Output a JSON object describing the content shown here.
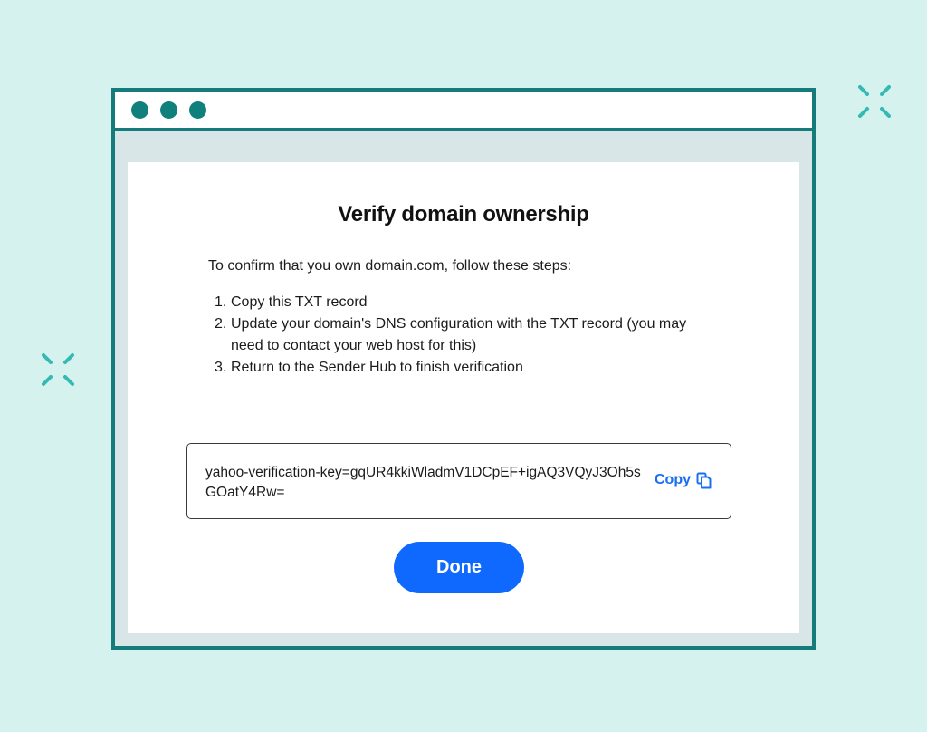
{
  "dialog": {
    "title": "Verify domain ownership",
    "intro": "To confirm that you own domain.com, follow these steps:",
    "steps": [
      {
        "number": "1.",
        "text": "Copy this TXT record"
      },
      {
        "number": "2.",
        "text": "Update your domain's DNS configuration with the TXT record (you may need to contact your web host for this)"
      },
      {
        "number": "3.",
        "text": "Return to the Sender Hub to finish verification"
      }
    ],
    "txt_record": "yahoo-verification-key=gqUR4kkiWladmV1DCpEF+igAQ3VQyJ3Oh5sGOatY4Rw=",
    "copy_label": "Copy",
    "done_label": "Done"
  },
  "icons": {
    "copy": "copy-icon",
    "sparkle": "sparkle-icon",
    "window_dot": "window-dot-icon"
  },
  "colors": {
    "background": "#d5f2ee",
    "window_border": "#157c7b",
    "accent_blue": "#0f69ff",
    "sparkle": "#35b9b3"
  }
}
